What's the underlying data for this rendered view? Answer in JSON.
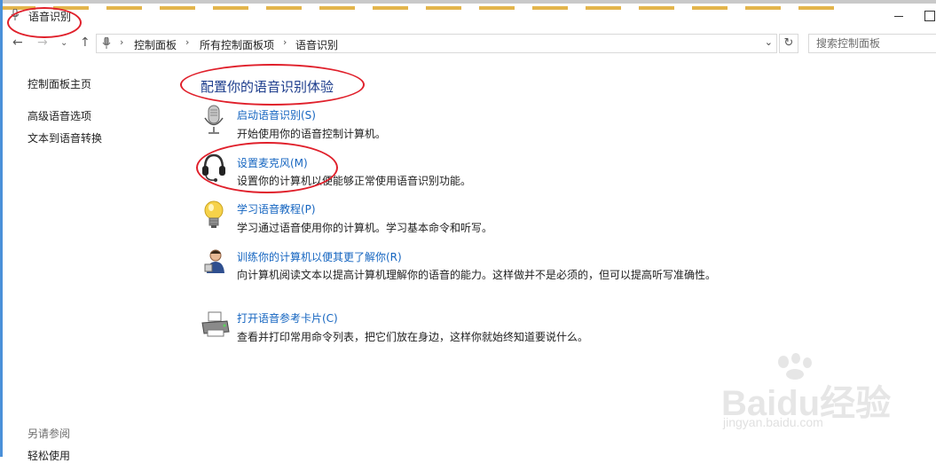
{
  "window": {
    "title": "语音识别"
  },
  "address_bar": {
    "crumbs": [
      "控制面板",
      "所有控制面板项",
      "语音识别"
    ]
  },
  "search": {
    "placeholder": "搜索控制面板"
  },
  "sidebar": {
    "links": [
      "控制面板主页",
      "高级语音选项",
      "文本到语音转换"
    ],
    "see_also_heading": "另请参阅",
    "see_also_links": [
      "轻松使用"
    ]
  },
  "main": {
    "title": "配置你的语音识别体验",
    "items": [
      {
        "icon": "microphone-icon",
        "link": "启动语音识别(S)",
        "description": "开始使用你的语音控制计算机。"
      },
      {
        "icon": "headset-icon",
        "link": "设置麦克风(M)",
        "description": "设置你的计算机以便能够正常使用语音识别功能。"
      },
      {
        "icon": "lightbulb-icon",
        "link": "学习语音教程(P)",
        "description": "学习通过语音使用你的计算机。学习基本命令和听写。"
      },
      {
        "icon": "user-training-icon",
        "link": "训练你的计算机以便其更了解你(R)",
        "description": "向计算机阅读文本以提高计算机理解你的语音的能力。这样做并不是必须的，但可以提高听写准确性。"
      },
      {
        "icon": "printer-icon",
        "link": "打开语音参考卡片(C)",
        "description": "查看并打印常用命令列表，把它们放在身边，这样你就始终知道要说什么。"
      }
    ]
  },
  "watermark": {
    "brand": "Baidu经验",
    "url": "jingyan.baidu.com"
  },
  "colors": {
    "link": "#1565c0",
    "title": "#1c3c8c",
    "annotation": "#e0202b"
  }
}
